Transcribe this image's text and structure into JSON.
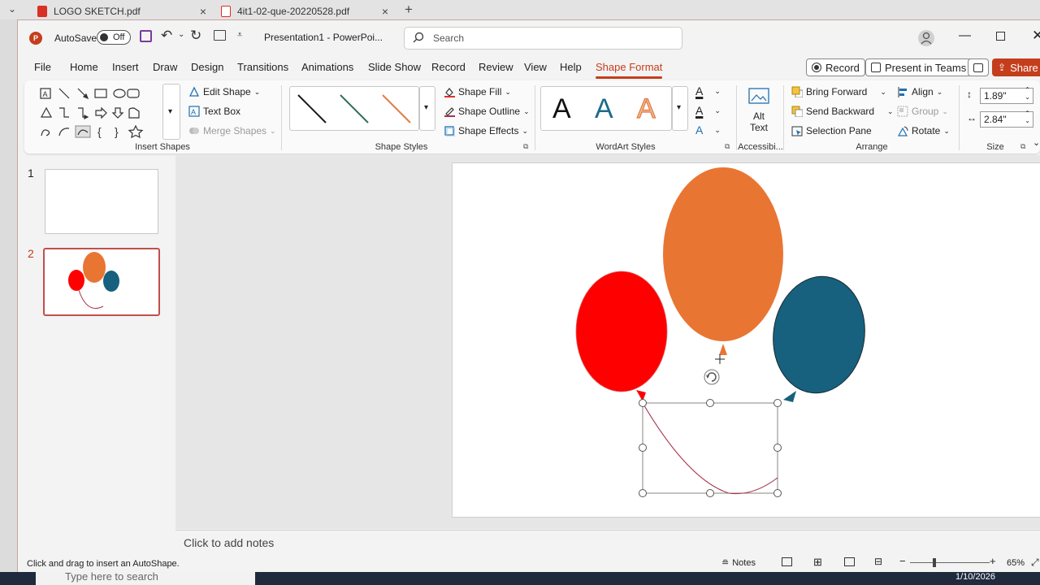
{
  "browser": {
    "tabs": [
      {
        "label": "LOGO SKETCH.pdf",
        "close": "×"
      },
      {
        "label": "4it1-02-que-20220528.pdf",
        "close": "×"
      }
    ],
    "new_tab": "+"
  },
  "titlebar": {
    "autosave_label": "AutoSave",
    "autosave_state": "Off",
    "doc_title": "Presentation1  -  PowerPoi...",
    "search_placeholder": "Search"
  },
  "menu": {
    "tabs": [
      "File",
      "Home",
      "Insert",
      "Draw",
      "Design",
      "Transitions",
      "Animations",
      "Slide Show",
      "Record",
      "Review",
      "View",
      "Help",
      "Shape Format"
    ],
    "active": "Shape Format",
    "record_button": "Record",
    "present_button": "Present in Teams",
    "share_button": "Share"
  },
  "ribbon": {
    "insert_shapes": {
      "label": "Insert Shapes",
      "edit_shape": "Edit Shape",
      "text_box": "Text Box",
      "merge_shapes": "Merge Shapes"
    },
    "shape_styles": {
      "label": "Shape Styles",
      "line_colors": [
        "#1a1a1a",
        "#2f6f5e",
        "#e07b46"
      ],
      "shape_fill": "Shape Fill",
      "shape_outline": "Shape Outline",
      "shape_effects": "Shape Effects"
    },
    "wordart": {
      "label": "WordArt Styles",
      "samples": [
        "A",
        "A",
        "A"
      ],
      "sample_colors": [
        "#111111",
        "#1d6b8a",
        "#f2b88f"
      ]
    },
    "accessibility": {
      "label": "Accessibi...",
      "alt_text_1": "Alt",
      "alt_text_2": "Text"
    },
    "arrange": {
      "label": "Arrange",
      "bring_forward": "Bring Forward",
      "send_backward": "Send Backward",
      "selection_pane": "Selection Pane",
      "align": "Align",
      "group": "Group",
      "rotate": "Rotate"
    },
    "size": {
      "label": "Size",
      "height": "1.89\"",
      "width": "2.84\""
    }
  },
  "thumbnails": [
    {
      "number": "1"
    },
    {
      "number": "2"
    }
  ],
  "slide": {
    "balloon_colors": {
      "red": "#ff0000",
      "orange": "#e97532",
      "teal": "#17607e",
      "string": "#a8324a"
    }
  },
  "notes": {
    "placeholder": "Click to add notes"
  },
  "status": {
    "message": "Click and drag to insert an AutoShape.",
    "notes_button": "Notes",
    "zoom_minus": "−",
    "zoom_plus": "+",
    "zoom": "65%"
  },
  "taskbar": {
    "search_placeholder": "Type here to search",
    "date": "1/10/2026"
  }
}
